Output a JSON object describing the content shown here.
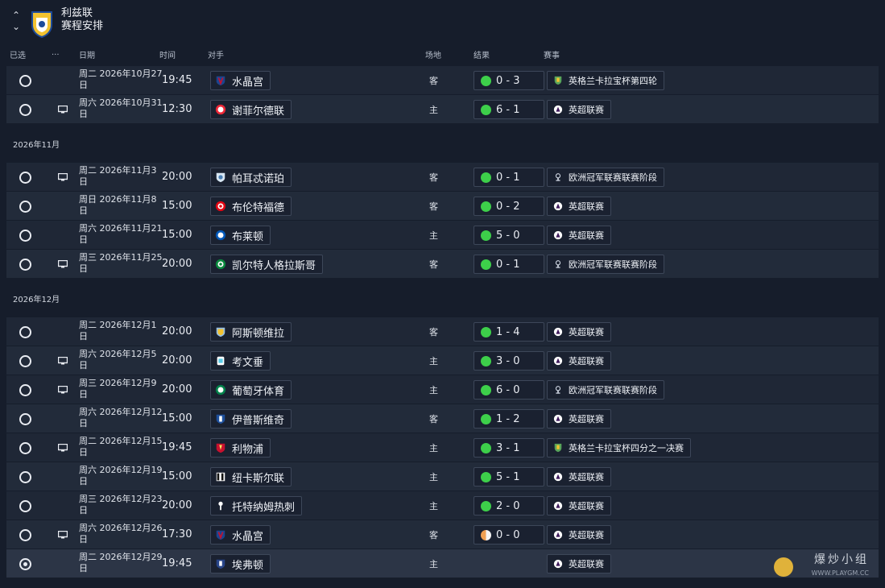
{
  "header": {
    "club": "利兹联",
    "title": "赛程安排"
  },
  "columns": {
    "selected": "已选",
    "tv": "...",
    "date": "日期",
    "time": "时间",
    "opponent": "对手",
    "venue": "场地",
    "result": "结果",
    "competition": "赛事"
  },
  "colors": {
    "win": "#3dcf4a",
    "draw": "#f0a052",
    "accent_gold": "#e0b23a"
  },
  "top_matches": [
    {
      "date": "周二 2026年10月27日",
      "time": "19:45",
      "opponent": "水晶宫",
      "crest": "crystal-palace",
      "venue": "客",
      "score": "0 - 3",
      "result": "win",
      "competition": "英格兰卡拉宝杯第四轮",
      "comp_icon": "carabao-cup",
      "tv": false
    },
    {
      "date": "周六 2026年10月31日",
      "time": "12:30",
      "opponent": "谢菲尔德联",
      "crest": "sheffield-united",
      "venue": "主",
      "score": "6 - 1",
      "result": "win",
      "competition": "英超联赛",
      "comp_icon": "premier-league",
      "tv": true
    }
  ],
  "nov": {
    "label": "2026年11月",
    "matches": [
      {
        "date": "周二 2026年11月3日",
        "time": "20:00",
        "opponent": "帕耳忒诺珀",
        "crest": "napoli",
        "venue": "客",
        "score": "0 - 1",
        "result": "win",
        "competition": "欧洲冠军联赛联赛阶段",
        "comp_icon": "champions-league",
        "tv": true
      },
      {
        "date": "周日 2026年11月8日",
        "time": "15:00",
        "opponent": "布伦特福德",
        "crest": "brentford",
        "venue": "客",
        "score": "0 - 2",
        "result": "win",
        "competition": "英超联赛",
        "comp_icon": "premier-league",
        "tv": false
      },
      {
        "date": "周六 2026年11月21日",
        "time": "15:00",
        "opponent": "布莱顿",
        "crest": "brighton",
        "venue": "主",
        "score": "5 - 0",
        "result": "win",
        "competition": "英超联赛",
        "comp_icon": "premier-league",
        "tv": false
      },
      {
        "date": "周三 2026年11月25日",
        "time": "20:00",
        "opponent": "凯尔特人格拉斯哥",
        "crest": "celtic",
        "venue": "客",
        "score": "0 - 1",
        "result": "win",
        "competition": "欧洲冠军联赛联赛阶段",
        "comp_icon": "champions-league",
        "tv": true
      }
    ]
  },
  "dec": {
    "label": "2026年12月",
    "matches": [
      {
        "date": "周二 2026年12月1日",
        "time": "20:00",
        "opponent": "阿斯顿维拉",
        "crest": "aston-villa",
        "venue": "客",
        "score": "1 - 4",
        "result": "win",
        "competition": "英超联赛",
        "comp_icon": "premier-league",
        "tv": false
      },
      {
        "date": "周六 2026年12月5日",
        "time": "20:00",
        "opponent": "考文垂",
        "crest": "coventry",
        "venue": "主",
        "score": "3 - 0",
        "result": "win",
        "competition": "英超联赛",
        "comp_icon": "premier-league",
        "tv": true
      },
      {
        "date": "周三 2026年12月9日",
        "time": "20:00",
        "opponent": "葡萄牙体育",
        "crest": "sporting",
        "venue": "主",
        "score": "6 - 0",
        "result": "win",
        "competition": "欧洲冠军联赛联赛阶段",
        "comp_icon": "champions-league",
        "tv": true
      },
      {
        "date": "周六 2026年12月12日",
        "time": "15:00",
        "opponent": "伊普斯维奇",
        "crest": "ipswich",
        "venue": "客",
        "score": "1 - 2",
        "result": "win",
        "competition": "英超联赛",
        "comp_icon": "premier-league",
        "tv": false
      },
      {
        "date": "周二 2026年12月15日",
        "time": "19:45",
        "opponent": "利物浦",
        "crest": "liverpool",
        "venue": "主",
        "score": "3 - 1",
        "result": "win",
        "competition": "英格兰卡拉宝杯四分之一决赛",
        "comp_icon": "carabao-cup",
        "tv": true
      },
      {
        "date": "周六 2026年12月19日",
        "time": "15:00",
        "opponent": "纽卡斯尔联",
        "crest": "newcastle",
        "venue": "主",
        "score": "5 - 1",
        "result": "win",
        "competition": "英超联赛",
        "comp_icon": "premier-league",
        "tv": false
      },
      {
        "date": "周三 2026年12月23日",
        "time": "20:00",
        "opponent": "托特纳姆热刺",
        "crest": "tottenham",
        "venue": "主",
        "score": "2 - 0",
        "result": "win",
        "competition": "英超联赛",
        "comp_icon": "premier-league",
        "tv": false
      },
      {
        "date": "周六 2026年12月26日",
        "time": "17:30",
        "opponent": "水晶宫",
        "crest": "crystal-palace",
        "venue": "客",
        "score": "0 - 0",
        "result": "draw",
        "competition": "英超联赛",
        "comp_icon": "premier-league",
        "tv": true
      },
      {
        "date": "周二 2026年12月29日",
        "time": "19:45",
        "opponent": "埃弗顿",
        "crest": "everton",
        "venue": "主",
        "score": "",
        "result": "none",
        "competition": "英超联赛",
        "comp_icon": "premier-league",
        "tv": false,
        "selected": true
      }
    ]
  },
  "watermark": {
    "text": "爆炒小组",
    "url": "WWW.PLAYGM.CC"
  }
}
